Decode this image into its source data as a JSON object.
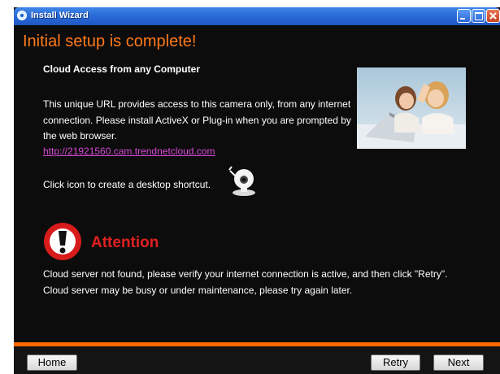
{
  "window": {
    "title": "Install Wizard"
  },
  "content": {
    "heading": "Initial setup is complete!",
    "subheading": "Cloud Access from any Computer",
    "paragraph": "This unique URL provides access to this camera only, from any internet connection. Please install ActiveX or Plug-in when you are prompted by the web browser.",
    "link": "http://21921560.cam.trendnetcloud.com",
    "shortcut_text": "Click icon to create a desktop shortcut."
  },
  "alert": {
    "title": "Attention",
    "line1": "Cloud server not found, please verify your internet connection is active, and then click \"Retry\".",
    "line2": "Cloud server may be busy or under maintenance, please try again later."
  },
  "footer": {
    "home_label": "Home",
    "retry_label": "Retry",
    "next_label": "Next"
  },
  "colors": {
    "accent": "#ff6a00",
    "heading": "#ff7a1a",
    "alert": "#e02020",
    "link": "#d84ad8",
    "background": "#0c0c0c"
  },
  "icons": {
    "camera": "camera-icon",
    "alert": "exclamation-icon"
  }
}
